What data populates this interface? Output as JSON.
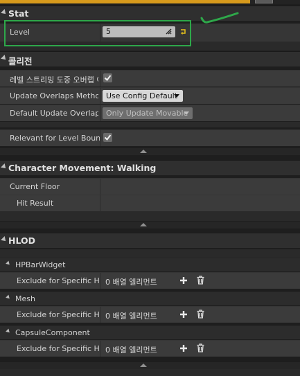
{
  "sections": {
    "stat": {
      "title": "Stat",
      "level_label": "Level",
      "level_value": "5"
    },
    "collision": {
      "title": "콜리전",
      "row1_label": "레벨 스트리밍 도중 오버랩 이",
      "row1_checked": true,
      "row2_label": "Update Overlaps Method D",
      "row2_value": "Use Config Default",
      "row3_label": "Default Update Overlaps M",
      "row3_value": "Only Update Movable",
      "row4_label": "Relevant for Level Bounds",
      "row4_checked": true
    },
    "movement": {
      "title": "Character Movement: Walking",
      "current_floor": "Current Floor",
      "hit_result": "Hit Result"
    },
    "hlod": {
      "title": "HLOD",
      "groups": [
        {
          "name": "HPBarWidget",
          "label": "Exclude for Specific HLC",
          "value": "0 배열 엘리먼트"
        },
        {
          "name": "Mesh",
          "label": "Exclude for Specific HLC",
          "value": "0 배열 엘리먼트"
        },
        {
          "name": "CapsuleComponent",
          "label": "Exclude for Specific HLC",
          "value": "0 배열 엘리먼트"
        }
      ]
    }
  },
  "colors": {
    "accent_orange": "#d79a1c",
    "annotation_green": "#2ea84a",
    "reset_yellow": "#e8c31a"
  },
  "icons": {
    "reset": "reset-arrow-icon",
    "add": "plus-icon",
    "delete": "trash-icon",
    "check": "checkmark-icon",
    "expand": "caret-up-icon"
  }
}
